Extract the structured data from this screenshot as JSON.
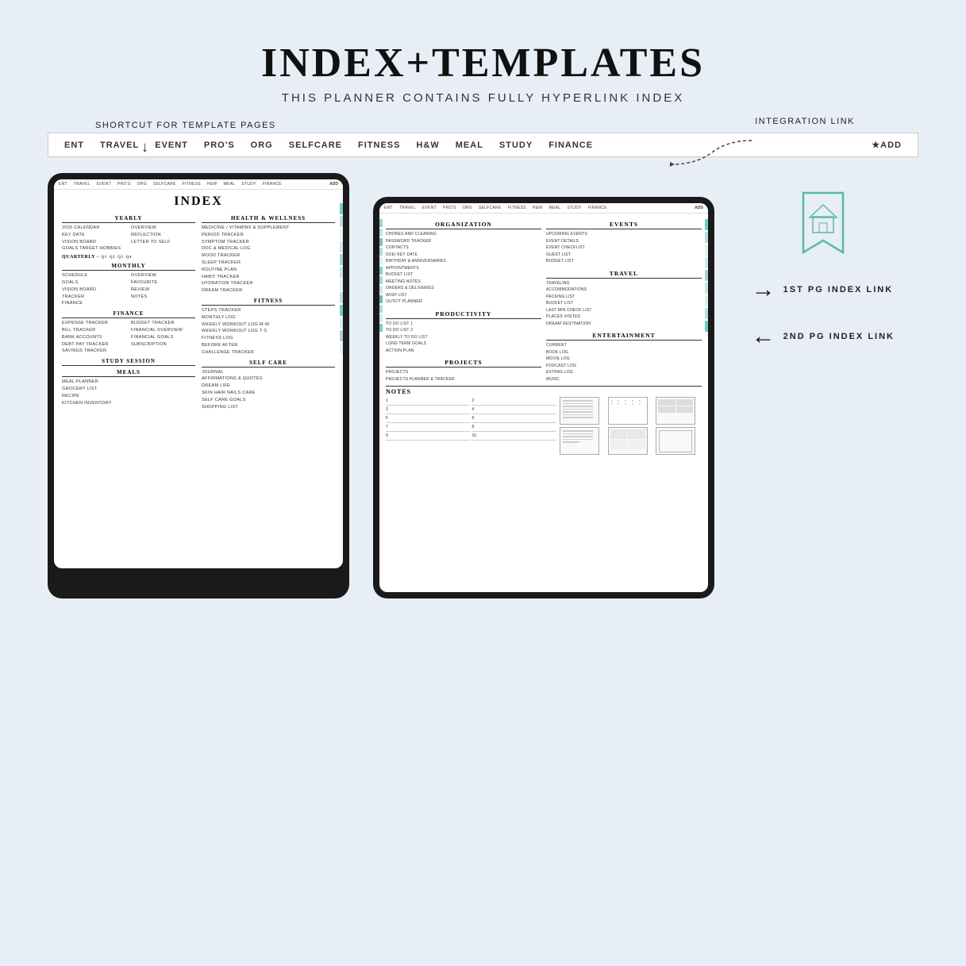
{
  "header": {
    "title": "INDEX+TEMPLATES",
    "subtitle": "THIS PLANNER CONTAINS FULLY HYPERLINK INDEX"
  },
  "labels": {
    "shortcut_for_template": "SHORTCUT FOR TEMPLATE PAGES",
    "integration_link": "INTEGRATION LINK",
    "first_pg_index": "1ST PG INDEX LINK",
    "second_pg_index": "2ND PG INDEX LINK"
  },
  "nav_bar": {
    "items": [
      "ENT",
      "TRAVEL",
      "EVENT",
      "PRO'S",
      "ORG",
      "SELFCARE",
      "FITNESS",
      "H&W",
      "MEAL",
      "STUDY",
      "FINANCE"
    ],
    "add_label": "★ADD"
  },
  "tablet1": {
    "nav_items": [
      "ENT",
      "TRAVEL",
      "EVENT",
      "PRO'S",
      "ORG",
      "SELFCARE",
      "FITNESS",
      "H&W",
      "MEAL",
      "STUDY",
      "FINANCE"
    ],
    "nav_add": "ADD",
    "title": "INDEX",
    "sections": {
      "yearly": {
        "title": "YEARLY",
        "col1": [
          "2025 CALENDAR",
          "KEY DATE",
          "VISION BOARD",
          "GOALS TARGET HOBBIES"
        ],
        "col2": [
          "OVERVIEW",
          "REFLECTION",
          "LETTER TO SELF"
        ]
      },
      "quarterly": {
        "title": "QUARTERLY -",
        "quarters": [
          "Q1",
          "Q2",
          "Q3",
          "Q4"
        ]
      },
      "monthly": {
        "title": "MONTHLY",
        "col1": [
          "SCHEDULE",
          "GOALS",
          "VISION BOARD",
          "TRACKER",
          "FINANCE"
        ],
        "col2": [
          "OVERVIEW",
          "FAVOURITE",
          "REVIEW",
          "NOTES"
        ]
      },
      "finance": {
        "title": "FINANCE",
        "col1": [
          "EXPENSE TRACKER",
          "BILL TRACKER",
          "BANK ACCOUNTS",
          "DEBT PAY TRACKER",
          "SAVINGS TRACKER"
        ],
        "col2": [
          "BUDGET TRACKER",
          "FINANCIAL OVERVIEW",
          "FINANCIAL GOALS",
          "SUBSCRIPTION"
        ]
      },
      "study": {
        "title": "STUDY SESSION"
      },
      "meals": {
        "title": "MEALS",
        "items": [
          "MEAL PLANNER",
          "GROCERY LIST",
          "RECIPE",
          "KITCHEN INVENTORY"
        ]
      }
    },
    "health_wellness": {
      "title": "HEALTH & WELLNESS",
      "items": [
        "MEDICINE / VITAMINS & SUPPLEMENT",
        "PERIOD TRACKER",
        "SYMPTOM TRACKER",
        "DOC & MEDICAL LOG",
        "MOOD TRACKER",
        "SLEEP TRACKER",
        "ROUTINE PLAN",
        "HABIT TRACKER",
        "HYDRATION TRACKER",
        "DREAM TRACKER"
      ]
    },
    "fitness": {
      "title": "FITNESS",
      "items": [
        "STEPS TRACKER",
        "MONTHLY LOG",
        "WEEKLY WORKOUT LOG M-W",
        "WEEKLY WORKOUT LOG T-S",
        "FITNESS LOG",
        "BEFORE AFTER",
        "CHALLENGE TRACKER"
      ]
    },
    "self_care": {
      "title": "SELF CARE",
      "items": [
        "JOURNAL",
        "AFFIRMATIONS & QUOTES",
        "DREAM LIFE",
        "SKIN HAIR NAILS CARE",
        "SELF CARE GOALS",
        "SHOPPING LIST"
      ]
    }
  },
  "tablet2": {
    "nav_items": [
      "ENT",
      "TRAVEL",
      "EVENT",
      "PRO'S",
      "ORG",
      "SELFCARE",
      "FITNESS",
      "H&W",
      "MEAL",
      "STUDY",
      "FINANCE"
    ],
    "nav_add": "ADD",
    "organization": {
      "title": "ORGANIZATION",
      "items": [
        "CHORES AND CLEANING",
        "PASSWORD TRACKER",
        "CONTACTS",
        "DUE/ KEY DATE",
        "BIRTHDAY & ANNIVERSARIES",
        "APPOINTMENTS",
        "BUCKET LIST",
        "MEETING NOTES",
        "ORDERS & DELIVERIES",
        "WISH LIST",
        "OUTFIT PLANNER"
      ]
    },
    "events": {
      "title": "EVENTS",
      "items": [
        "UPCOMING EVENTS",
        "EVENT DETAILS",
        "EVENT CHECKLIST",
        "GUEST LIST",
        "BUDGET LIST"
      ]
    },
    "productivity": {
      "title": "PRODUCTIVITY",
      "items": [
        "TO DO LIST 1",
        "TO DO LIST 2",
        "WEEKLY TO DO LIST",
        "LONG TERM GOALS",
        "ACTION PLAN"
      ]
    },
    "travel": {
      "title": "TRAVEL",
      "items": [
        "TRAVELING",
        "ACCOMMODATIONS",
        "PACKING LIST",
        "BUCKET LIST",
        "LAST MIN CHECK LIST",
        "PLACES VISITED",
        "DREAM DESTINATION"
      ]
    },
    "projects": {
      "title": "PROJECTS",
      "items": [
        "PROJECTS",
        "PROJECTS PLANNER & TRACKER"
      ]
    },
    "entertainment": {
      "title": "ENTERTAINMENT",
      "items": [
        "CURRENT",
        "BOOK LOG",
        "MOVIE LOG",
        "PODCAST LOG",
        "EXTRAS LOG",
        "MUSIC"
      ]
    },
    "notes": {
      "title": "NOTES",
      "numbers": [
        "1",
        "2",
        "3",
        "4",
        "5",
        "6",
        "7",
        "8",
        "9",
        "10"
      ]
    }
  }
}
